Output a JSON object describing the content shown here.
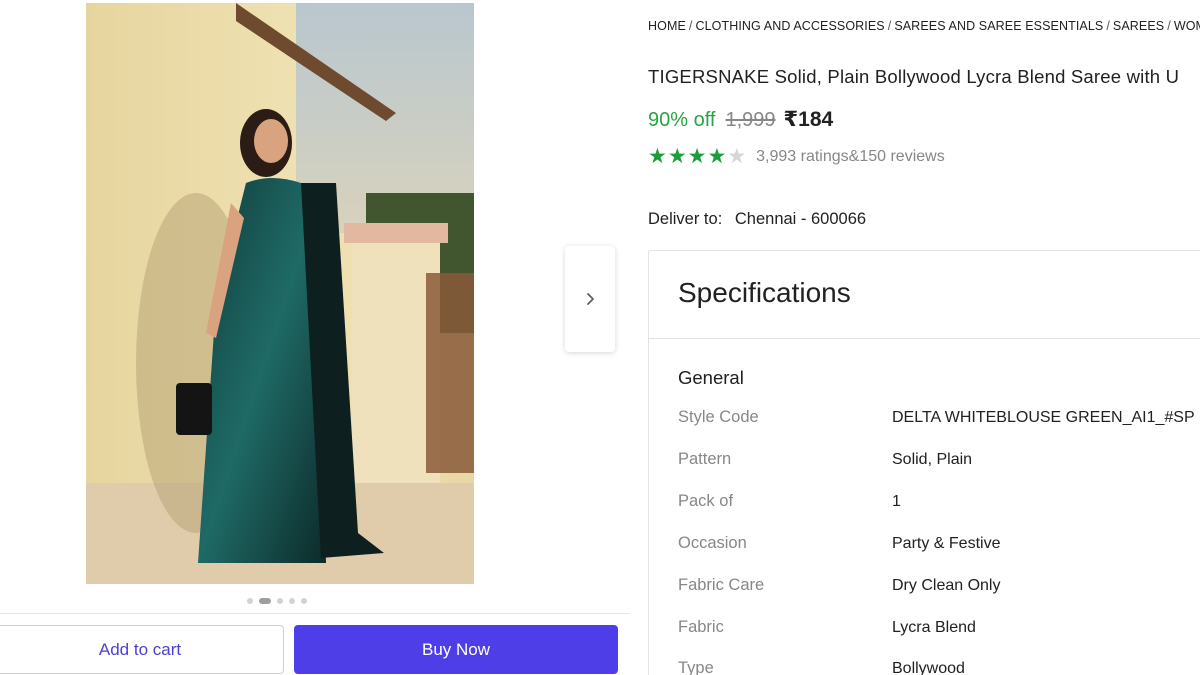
{
  "gallery": {
    "image_alt_icon": "product-photo",
    "next_icon": "chevron-right-icon",
    "dots_count": 5,
    "active_dot_index": 1
  },
  "actions": {
    "add_to_cart": "Add to cart",
    "buy_now": "Buy Now"
  },
  "breadcrumb": [
    "HOME",
    "CLOTHING AND ACCESSORIES",
    "SAREES AND SAREE ESSENTIALS",
    "SAREES",
    "WOMEN'S"
  ],
  "product": {
    "title": "TIGERSNAKE Solid, Plain Bollywood Lycra Blend Saree with U",
    "discount": "90% off",
    "mrp": "1,999",
    "price": "₹184",
    "rating_stars": 4,
    "rating_max": 5,
    "ratings": "3,993 ratings",
    "amp": "&",
    "reviews": "150 reviews"
  },
  "delivery": {
    "label": "Deliver to:",
    "location": "Chennai - 600066"
  },
  "specifications": {
    "title": "Specifications",
    "section": "General",
    "rows": [
      {
        "key": "Style Code",
        "value": "DELTA WHITEBLOUSE GREEN_AI1_#SP"
      },
      {
        "key": "Pattern",
        "value": "Solid, Plain"
      },
      {
        "key": "Pack of",
        "value": "1"
      },
      {
        "key": "Occasion",
        "value": "Party & Festive"
      },
      {
        "key": "Fabric Care",
        "value": "Dry Clean Only"
      },
      {
        "key": "Fabric",
        "value": "Lycra Blend"
      },
      {
        "key": "Type",
        "value": "Bollywood"
      }
    ]
  },
  "colors": {
    "discount_green": "#26a541",
    "star_green": "#1a9e3a",
    "buy_button": "#4d3ee8",
    "cart_text": "#4b3fd6"
  }
}
